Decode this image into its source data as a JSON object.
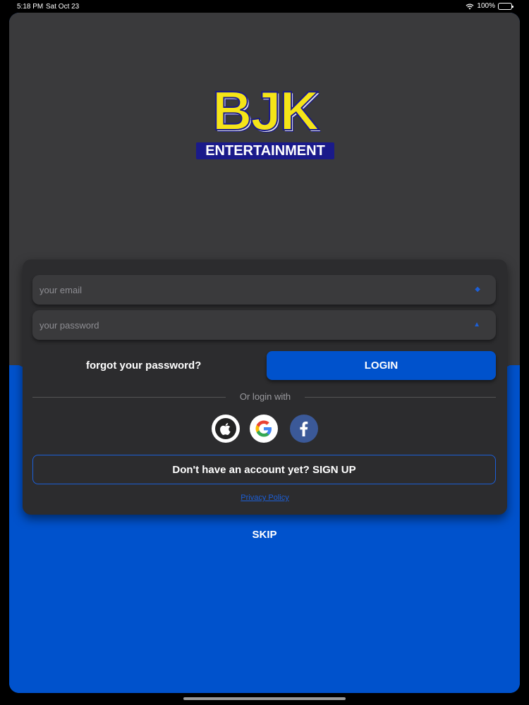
{
  "status_bar": {
    "time": "5:18 PM",
    "date": "Sat Oct 23",
    "battery": "100%"
  },
  "logo": {
    "title": "BJK",
    "subtitle": "ENTERTAINMENT"
  },
  "login": {
    "email_placeholder": "your email",
    "password_placeholder": "your password",
    "forgot_label": "forgot your password?",
    "login_label": "LOGIN",
    "divider_label": "Or login with",
    "signup_label": "Don't have an account yet? SIGN UP",
    "privacy_label": "Privacy Policy"
  },
  "social": [
    {
      "name": "apple-icon"
    },
    {
      "name": "google-icon"
    },
    {
      "name": "facebook-icon"
    }
  ],
  "skip_label": "SKIP",
  "colors": {
    "accent": "#0052cc",
    "card": "#2c2c2e",
    "panel": "#3a3a3c",
    "logo_yellow": "#f5e418",
    "logo_navy": "#1a1a8a",
    "facebook": "#3b5998"
  }
}
